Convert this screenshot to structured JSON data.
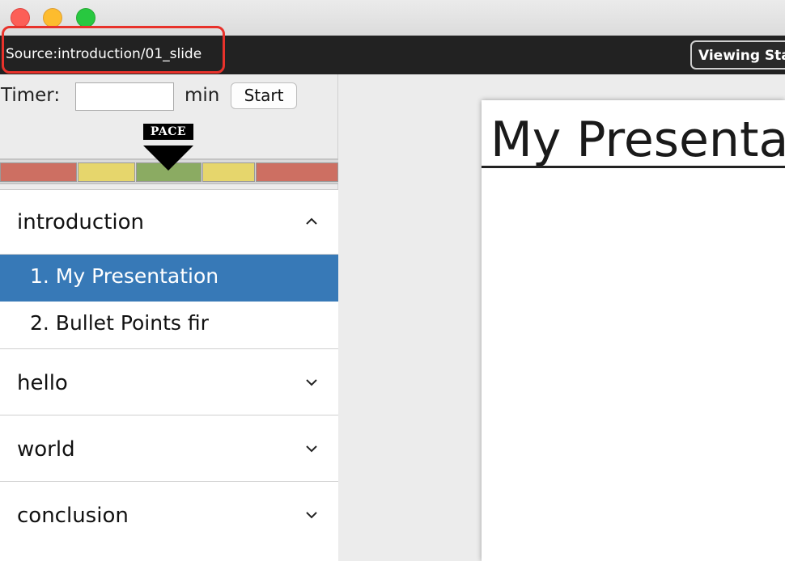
{
  "window": {
    "controls": [
      "close",
      "minimize",
      "zoom"
    ]
  },
  "toolbar": {
    "source_label": "Source:introduction/01_slide",
    "viewing_button": "Viewing Stat"
  },
  "timer": {
    "label": "Timer:",
    "value": "",
    "unit": "min",
    "start_button": "Start"
  },
  "pace": {
    "label": "PACE",
    "segments": [
      "red",
      "yellow",
      "green",
      "yellow",
      "red"
    ],
    "colors": {
      "red": "#cd6f62",
      "yellow": "#e6d66c",
      "green": "#8bab62"
    }
  },
  "outline": {
    "sections": [
      {
        "title": "introduction",
        "expanded": true,
        "chevron": "chevron-up-icon",
        "items": [
          {
            "label": "1. My Presentation",
            "selected": true
          },
          {
            "label": "2. Bullet Points fir",
            "selected": false
          }
        ]
      },
      {
        "title": "hello",
        "expanded": false,
        "chevron": "chevron-down-icon"
      },
      {
        "title": "world",
        "expanded": false,
        "chevron": "chevron-down-icon"
      },
      {
        "title": "conclusion",
        "expanded": false,
        "chevron": "chevron-down-icon"
      }
    ],
    "selection_color": "#3779b7"
  },
  "slide": {
    "title": "My Presentat"
  }
}
